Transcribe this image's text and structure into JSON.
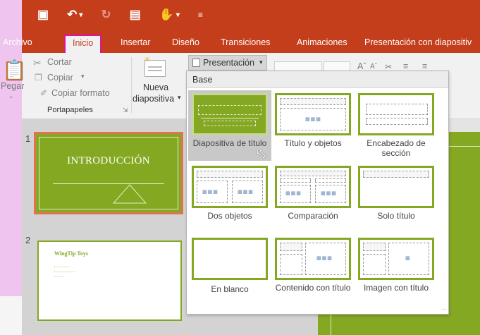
{
  "qat": {
    "save_icon": "save-icon",
    "undo_icon": "undo-icon",
    "redo_icon": "redo-icon",
    "start_icon": "start-from-beginning-icon",
    "touch_icon": "touch-mode-icon",
    "customize_icon": "customize-qat-icon"
  },
  "tabs": {
    "archivo": "Archivo",
    "inicio": "Inicio",
    "insertar": "Insertar",
    "diseno": "Diseño",
    "transiciones": "Transiciones",
    "animaciones": "Animaciones",
    "presentacion": "Presentación con diapositiv"
  },
  "ribbon": {
    "pegar": "Pegar",
    "cortar": "Cortar",
    "copiar": "Copiar",
    "copiar_formato": "Copiar formato",
    "portapapeles": "Portapapeles",
    "nueva": "Nueva",
    "diapositiva": "diapositiva",
    "presentacion_btn": "Presentación"
  },
  "dropdown": {
    "header": "Base",
    "layouts": [
      {
        "label": "Diapositiva de título"
      },
      {
        "label": "Título y objetos"
      },
      {
        "label": "Encabezado de sección"
      },
      {
        "label": "Dos objetos"
      },
      {
        "label": "Comparación"
      },
      {
        "label": "Solo título"
      },
      {
        "label": "En blanco"
      },
      {
        "label": "Contenido con título"
      },
      {
        "label": "Imagen con título"
      }
    ]
  },
  "slides": {
    "slide1_num": "1",
    "slide1_title": "INTRODUCCIÓN",
    "slide2_num": "2",
    "slide2_title": "WingTip Toys"
  },
  "colors": {
    "ribbon_red": "#c43e1c",
    "slide_green": "#85a823",
    "active_tab_outline": "#e0119a",
    "selected_slide_border": "#e0744f"
  }
}
